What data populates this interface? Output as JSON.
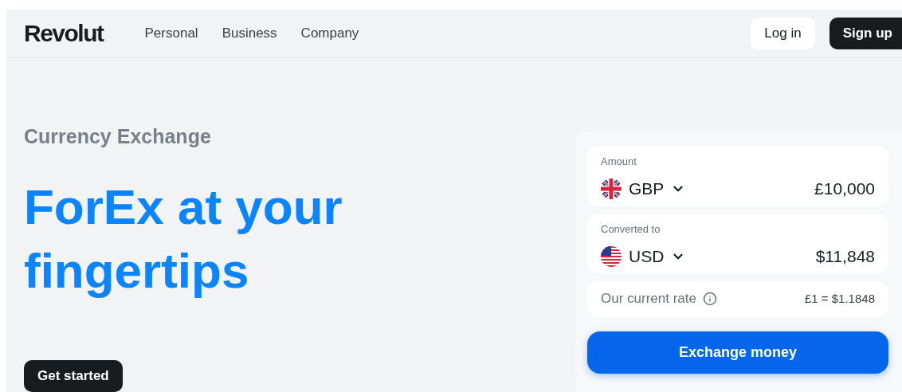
{
  "header": {
    "logo": "Revolut",
    "nav": [
      {
        "label": "Personal"
      },
      {
        "label": "Business"
      },
      {
        "label": "Company"
      }
    ],
    "login": "Log in",
    "signup": "Sign up"
  },
  "hero": {
    "eyebrow": "Currency Exchange",
    "title_lines": [
      "ForEx at your",
      "fingertips"
    ],
    "cta": "Get started"
  },
  "converter": {
    "rows": [
      {
        "label": "Amount",
        "currency": "GBP",
        "kind": "gb",
        "value": "£10,000"
      },
      {
        "label": "Converted to",
        "currency": "USD",
        "kind": "us",
        "value": "$11,848"
      }
    ],
    "rate": {
      "label": "Our current rate",
      "value": "£1 = $1.1848"
    },
    "button": "Exchange money"
  }
}
